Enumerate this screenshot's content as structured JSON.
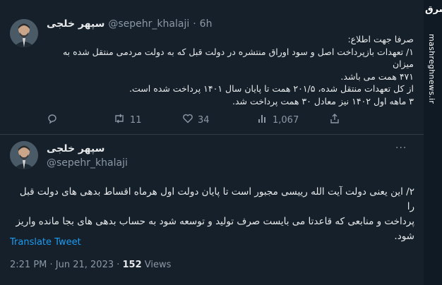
{
  "tweet1": {
    "display_name": "سپهر خلجی",
    "handle": "@sepehr_khalaji",
    "separator": "·",
    "time": "6h",
    "lines": [
      "صرفا جهت اطلاع:",
      "۱/ تعهدات بازپرداخت اصل و سود اوراق منتشره در دولت قبل که به دولت مردمی منتقل شده به میزان",
      "۴۷۱ همت می باشد.",
      "از کل تعهدات منتقل شده، ۲۰۱/۵ همت تا پایان سال ۱۴۰۱ پرداخت شده است.",
      "۳ ماهه اول ۱۴۰۲ نیز معادل ۳۰ همت پرداخت شد."
    ],
    "actions": {
      "replies": "",
      "retweets": "11",
      "likes": "34",
      "views": "1,067"
    }
  },
  "tweet2": {
    "display_name": "سپهر خلجی",
    "handle": "@sepehr_khalaji",
    "more": "···",
    "lines": [
      "۲/ این یعنی دولت آیت الله رییسی مجبور است تا پایان دولت اول هرماه اقساط بدهی های دولت قبل را",
      "پرداخت و منابعی که قاعدتا می بایست صرف تولید و توسعه شود به حساب بدهی های بجا مانده واریز",
      "شود."
    ],
    "translate": "Translate Tweet",
    "timestamp": "2:21 PM · Jun 21, 2023 · ",
    "views_count": "152",
    "views_label": " Views"
  },
  "watermark": {
    "logo": "مشرق",
    "text": "mashreghnews.ir"
  },
  "colors": {
    "background": "#15202b",
    "text": "#e7e9ea",
    "muted": "#8b98a5",
    "link": "#1d9bf0",
    "divider": "#2f3b46"
  }
}
